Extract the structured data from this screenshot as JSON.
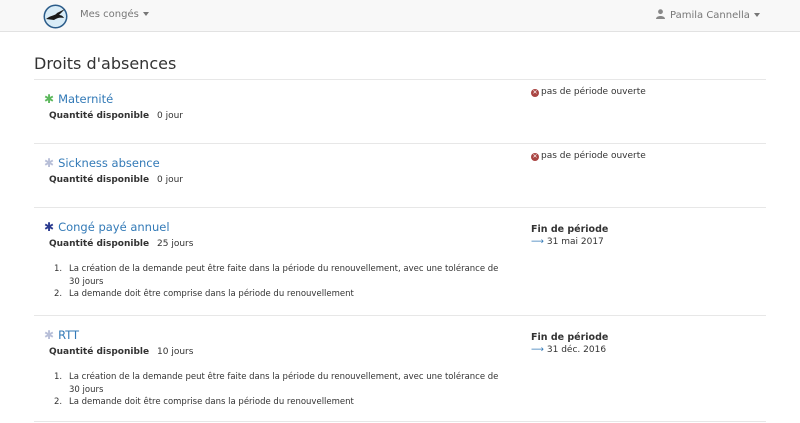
{
  "colors": {
    "maternite": "#5cb85c",
    "sickness": "#b8bfd8",
    "conge_paye": "#2a3a8f",
    "rtt": "#b8bfd8",
    "link": "#337ab7",
    "error": "#a94442"
  },
  "navbar": {
    "logo_icon": "swallow-logo-icon",
    "menu_label": "Mes congés",
    "user_name": "Pamila Cannella"
  },
  "page": {
    "title": "Droits d'absences"
  },
  "entries": [
    {
      "title": "Maternité",
      "qty_label": "Quantité disponible",
      "qty_value": "0 jour",
      "status": "pas de période ouverte"
    },
    {
      "title": "Sickness absence",
      "qty_label": "Quantité disponible",
      "qty_value": "0 jour",
      "status": "pas de période ouverte"
    },
    {
      "title": "Congé payé annuel",
      "qty_label": "Quantité disponible",
      "qty_value": "25 jours",
      "period_label": "Fin de période",
      "period_date": "31 mai 2017",
      "rules": [
        {
          "num": "1.",
          "line1": "La création de la demande peut être faite dans la période du renouvellement, avec une tolérance de",
          "line2": "30 jours"
        },
        {
          "num": "2.",
          "line1": "La demande doit être comprise dans la période du renouvellement"
        }
      ]
    },
    {
      "title": "RTT",
      "qty_label": "Quantité disponible",
      "qty_value": "10 jours",
      "period_label": "Fin de période",
      "period_date": "31 déc. 2016",
      "rules": [
        {
          "num": "1.",
          "line1": "La création de la demande peut être faite dans la période du renouvellement, avec une tolérance de",
          "line2": "30 jours"
        },
        {
          "num": "2.",
          "line1": "La demande doit être comprise dans la période du renouvellement"
        }
      ]
    }
  ]
}
